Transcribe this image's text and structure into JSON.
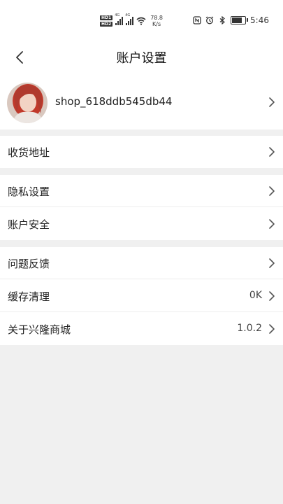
{
  "status_bar": {
    "sim1": "HD1",
    "sim2": "HD2",
    "net1": "4G",
    "net2": "4G",
    "speed_value": "78.8",
    "speed_unit": "K/s",
    "time": "5:46"
  },
  "navbar": {
    "title": "账户设置"
  },
  "profile": {
    "username": "shop_618ddb545db44"
  },
  "menu": {
    "address": {
      "label": "收货地址"
    },
    "privacy": {
      "label": "隐私设置"
    },
    "security": {
      "label": "账户安全"
    },
    "feedback": {
      "label": "问题反馈"
    },
    "cache": {
      "label": "缓存清理",
      "value": "0K"
    },
    "about": {
      "label": "关于兴隆商城",
      "value": "1.0.2"
    }
  },
  "colors": {
    "background": "#f0f0f0",
    "surface": "#ffffff",
    "text": "#222222",
    "chevron": "#666666"
  }
}
